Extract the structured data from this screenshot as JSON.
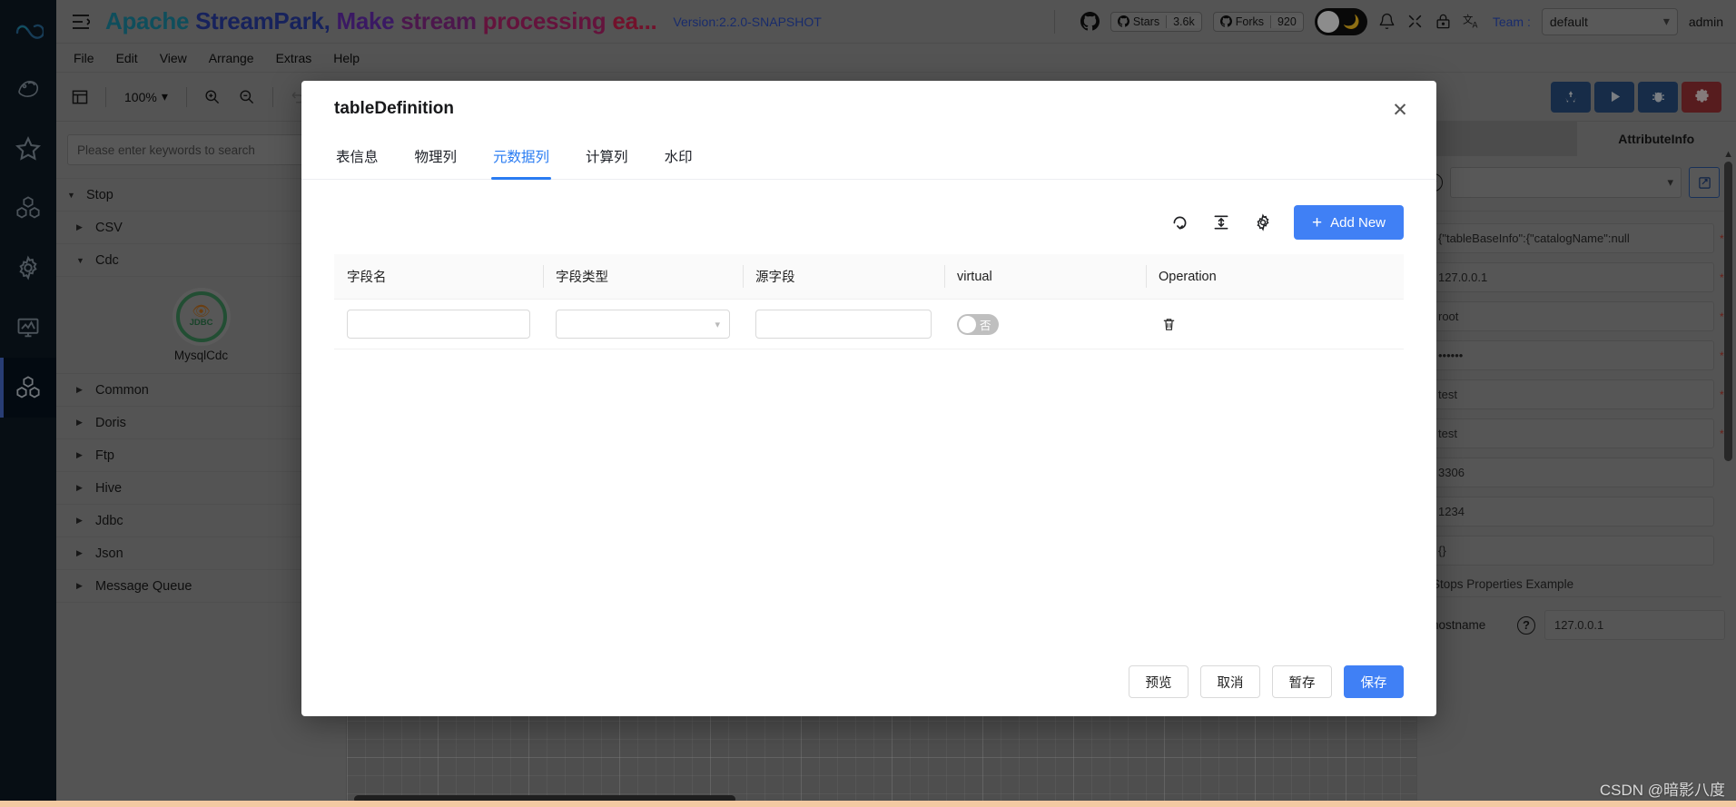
{
  "rail": {
    "items": [
      {
        "name": "logo-icon",
        "label": "StreamPark Logo"
      },
      {
        "name": "flink-icon",
        "label": "Flink"
      },
      {
        "name": "star-icon",
        "label": "Favorites"
      },
      {
        "name": "cubes-icon",
        "label": "Modules"
      },
      {
        "name": "gear-icon",
        "label": "Settings"
      },
      {
        "name": "monitor-chart-icon",
        "label": "Monitor"
      },
      {
        "name": "cubes-active-icon",
        "label": "Pipeline"
      }
    ]
  },
  "header": {
    "brand_parts": [
      "Apache",
      "StreamPark,",
      "Make",
      "stream",
      "processing",
      "ea..."
    ],
    "version": "Version:2.2.0-SNAPSHOT",
    "stars_label": "Stars",
    "stars_count": "3.6k",
    "forks_label": "Forks",
    "forks_count": "920",
    "team_label": "Team :",
    "team_value": "default",
    "user": "admin",
    "accent_blue": "#2d4fc4"
  },
  "menubar": {
    "items": [
      "File",
      "Edit",
      "View",
      "Arrange",
      "Extras",
      "Help"
    ]
  },
  "toolbar": {
    "zoom_level": "100%",
    "actions": [
      {
        "name": "deploy-button",
        "glyph": "♻"
      },
      {
        "name": "run-button",
        "glyph": "▶"
      },
      {
        "name": "debug-button",
        "glyph": "🐞"
      },
      {
        "name": "settings-button",
        "glyph": "⚙"
      }
    ]
  },
  "tree": {
    "search_placeholder": "Please enter keywords to search",
    "root": "Stop",
    "items": [
      {
        "label": "CSV",
        "expanded": false
      },
      {
        "label": "Cdc",
        "expanded": true
      },
      {
        "label": "Common",
        "expanded": false
      },
      {
        "label": "Doris",
        "expanded": false
      },
      {
        "label": "Ftp",
        "expanded": false
      },
      {
        "label": "Hive",
        "expanded": false
      },
      {
        "label": "Jdbc",
        "expanded": false
      },
      {
        "label": "Json",
        "expanded": false
      },
      {
        "label": "Message Queue",
        "expanded": false
      }
    ],
    "node": {
      "badge": "JDBC",
      "label": "MysqlCdc",
      "ring_color": "#3f8f5e"
    }
  },
  "attribute_panel": {
    "tab_left": "",
    "tab_title": "AttributeInfo",
    "select_value": "",
    "fields": [
      {
        "value": "{\"tableBaseInfo\":{\"catalogName\":null",
        "required": true
      },
      {
        "value": "127.0.0.1",
        "required": true
      },
      {
        "value": "root",
        "required": true
      },
      {
        "value": "••••••",
        "required": true
      },
      {
        "value": "test",
        "required": true
      },
      {
        "value": "test",
        "required": true
      },
      {
        "value": "3306",
        "required": false
      },
      {
        "value": "1234",
        "required": false
      },
      {
        "value": "{}",
        "required": false
      }
    ],
    "section_title": "Stops Properties Example",
    "properties": [
      {
        "name": "hostname",
        "value": "127.0.0.1"
      }
    ]
  },
  "watermark": "CSDN @暗影八度",
  "modal": {
    "title": "tableDefinition",
    "tabs": [
      {
        "label": "表信息",
        "active": false
      },
      {
        "label": "物理列",
        "active": false
      },
      {
        "label": "元数据列",
        "active": true
      },
      {
        "label": "计算列",
        "active": false
      },
      {
        "label": "水印",
        "active": false
      }
    ],
    "table_toolbar": {
      "reload_icon": "reload-icon",
      "density_icon": "density-icon",
      "setting_icon": "gear-icon",
      "add_new_label": "Add New"
    },
    "table": {
      "columns": [
        "字段名",
        "字段类型",
        "源字段",
        "virtual",
        "Operation"
      ],
      "rows": [
        {
          "field_name": "",
          "field_type": "",
          "source_field": "",
          "virtual": false,
          "virtual_label": "否"
        }
      ]
    },
    "footer_buttons": [
      {
        "label": "预览",
        "primary": false
      },
      {
        "label": "取消",
        "primary": false
      },
      {
        "label": "暂存",
        "primary": false
      },
      {
        "label": "保存",
        "primary": true
      }
    ]
  }
}
